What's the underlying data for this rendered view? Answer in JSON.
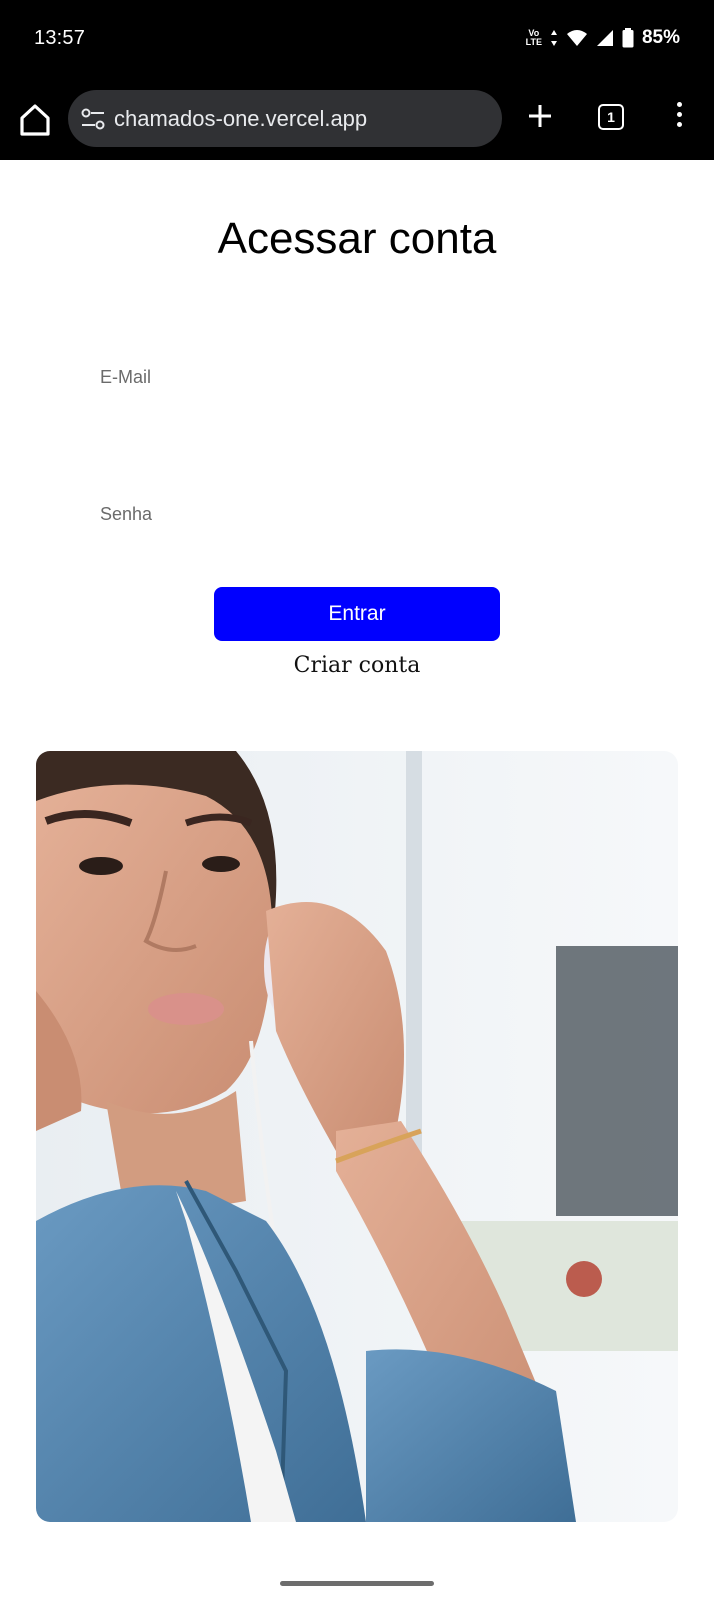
{
  "status_bar": {
    "time": "13:57",
    "network_label_top": "Vo",
    "network_label_bottom": "LTE",
    "battery": "85%"
  },
  "browser": {
    "url": "chamados-one.vercel.app",
    "tab_count": "1",
    "icons": [
      "home-icon",
      "site-settings-icon",
      "new-tab-icon",
      "tab-switcher-icon",
      "overflow-menu-icon"
    ]
  },
  "login": {
    "title": "Acessar conta",
    "email_label": "E-Mail",
    "password_label": "Senha",
    "submit_label": "Entrar",
    "create_account_label": "Criar conta"
  },
  "colors": {
    "accent": "#0000ff",
    "status_bar_bg": "#000000",
    "url_box_bg": "#303134"
  }
}
